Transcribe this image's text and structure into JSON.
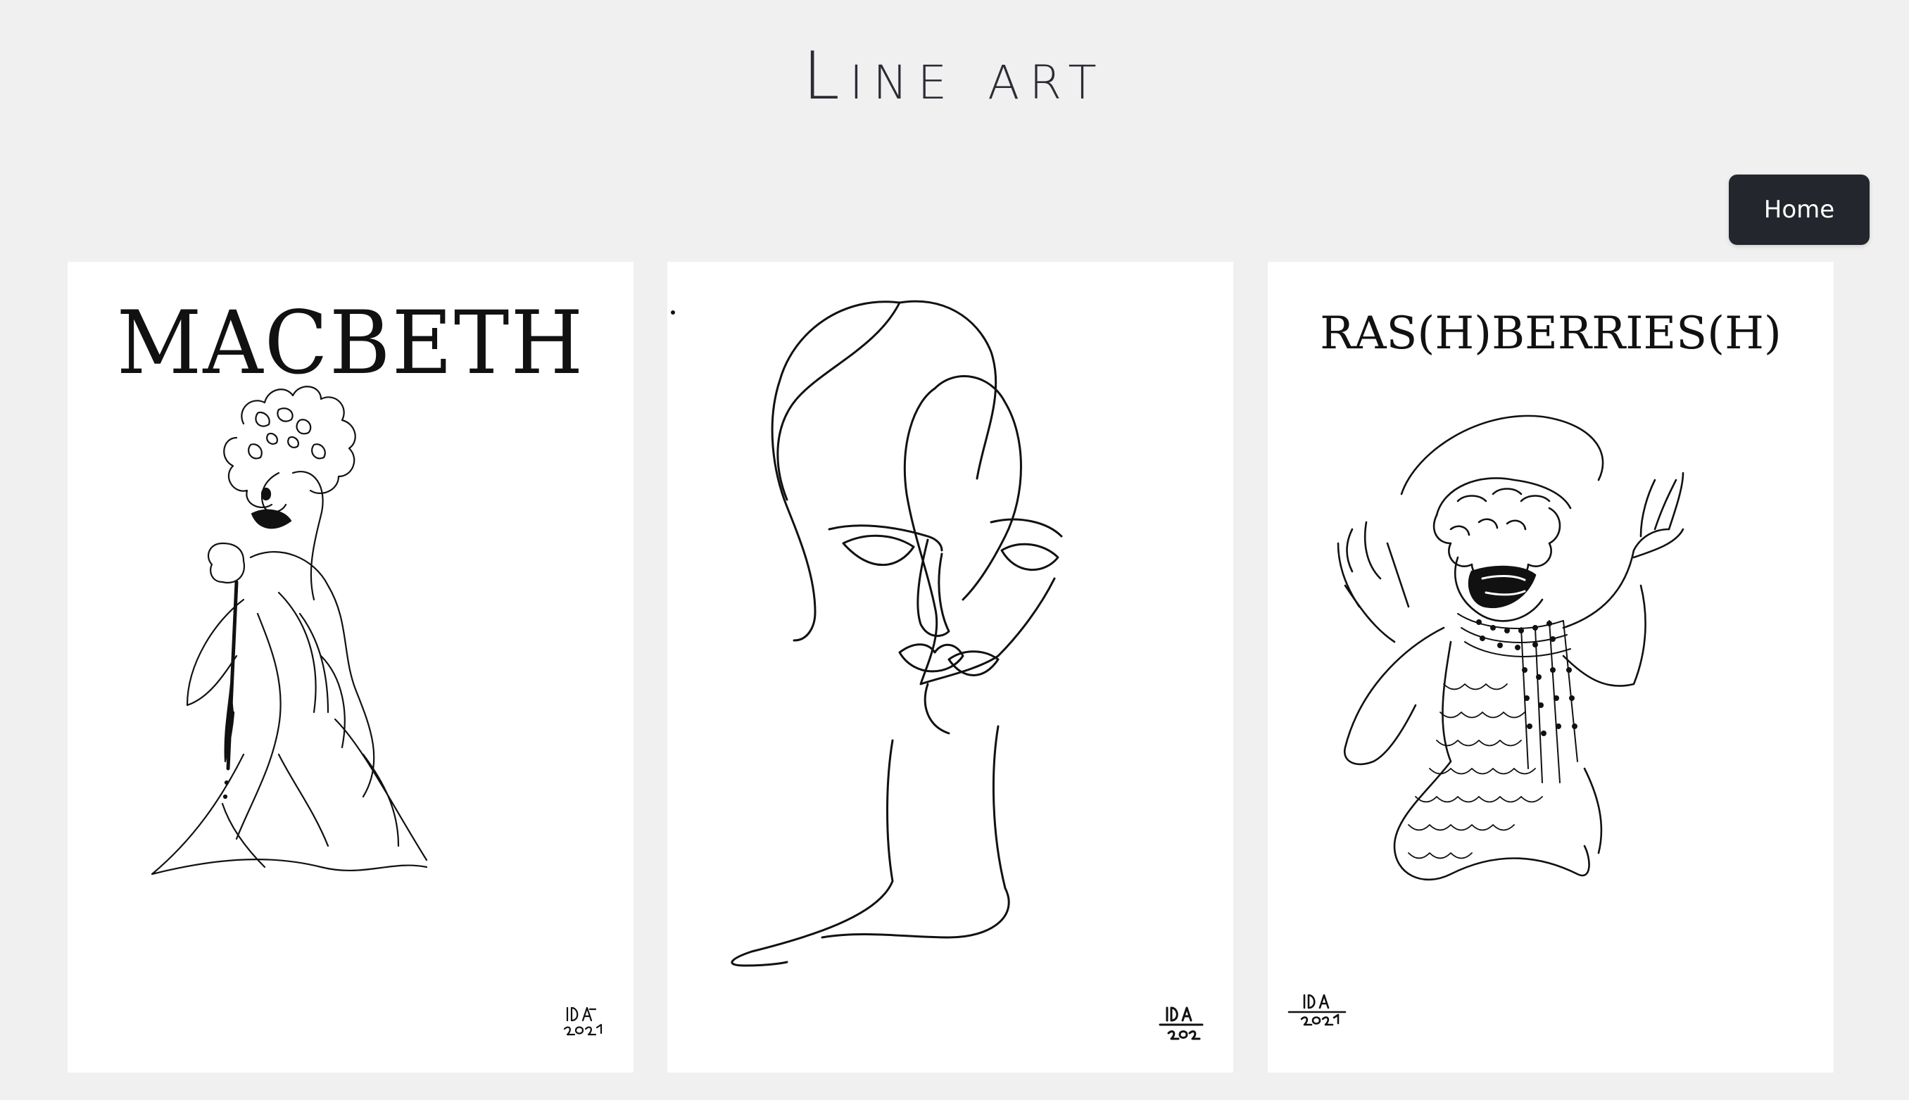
{
  "header": {
    "title": "Line art"
  },
  "nav": {
    "home_label": "Home"
  },
  "gallery": {
    "items": [
      {
        "title": "MACBETH",
        "signature": "IDA 2021"
      },
      {
        "title": "",
        "signature": "IDA 2021"
      },
      {
        "title": "RAS(H)BERRIES(H)",
        "signature": "IDA 2021"
      }
    ]
  },
  "colors": {
    "background": "#f0f0f1",
    "button_bg": "#23262c",
    "title_text": "#2b2d33",
    "card_bg": "#ffffff"
  }
}
